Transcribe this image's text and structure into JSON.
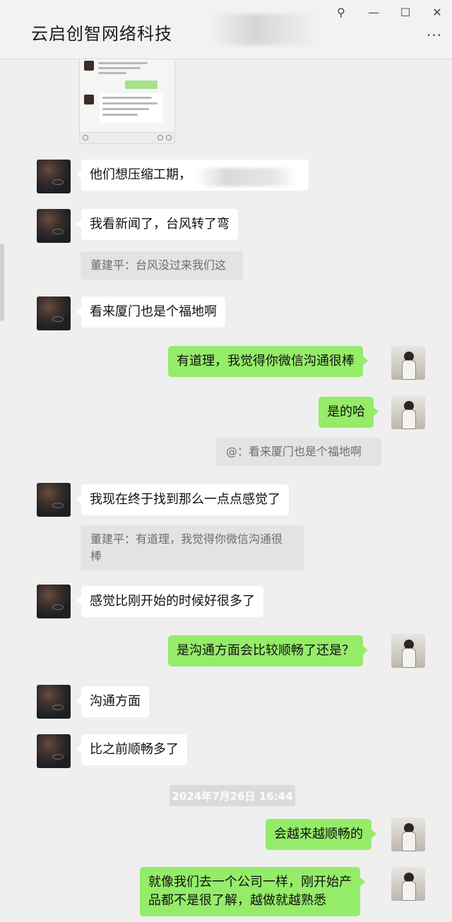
{
  "window": {
    "title": "云启创智网络科技",
    "pin_icon": "pin-icon",
    "minimize_icon": "minimize-icon",
    "maximize_icon": "maximize-icon",
    "close_icon": "close-icon",
    "more_icon": "more-icon",
    "pin_glyph": "⚲",
    "min_glyph": "—",
    "max_glyph": "☐",
    "close_glyph": "✕",
    "more_glyph": "···"
  },
  "messages": [
    {
      "side": "left",
      "text": "他们想压缩工期，"
    },
    {
      "side": "left",
      "text": "我看新闻了，台风转了弯",
      "quote": "董建平：台风没过来我们这"
    },
    {
      "side": "left",
      "text": "看来厦门也是个福地啊"
    },
    {
      "side": "right",
      "text": "有道理，我觉得你微信沟通很棒"
    },
    {
      "side": "right",
      "text": "是的哈",
      "quote": "@：看来厦门也是个福地啊"
    },
    {
      "side": "left",
      "text": "我现在终于找到那么一点点感觉了",
      "quote_line1": "董建平：有道理，我觉得你微信沟通很",
      "quote_line2": "棒"
    },
    {
      "side": "left",
      "text": "感觉比刚开始的时候好很多了"
    },
    {
      "side": "right",
      "text": "是沟通方面会比较顺畅了还是？"
    },
    {
      "side": "left",
      "text": "沟通方面"
    },
    {
      "side": "left",
      "text": "比之前顺畅多了"
    },
    {
      "side": "right",
      "text": "会越来越顺畅的"
    },
    {
      "side": "right",
      "text_line1": "就像我们去一个公司一样，刚开始产",
      "text_line2": "品都不是很了解，越做就越熟悉"
    }
  ],
  "timestamp": "2024年7月26日 16:44",
  "colors": {
    "sent_bubble": "#95ec69",
    "received_bubble": "#ffffff",
    "background": "#efefef"
  }
}
